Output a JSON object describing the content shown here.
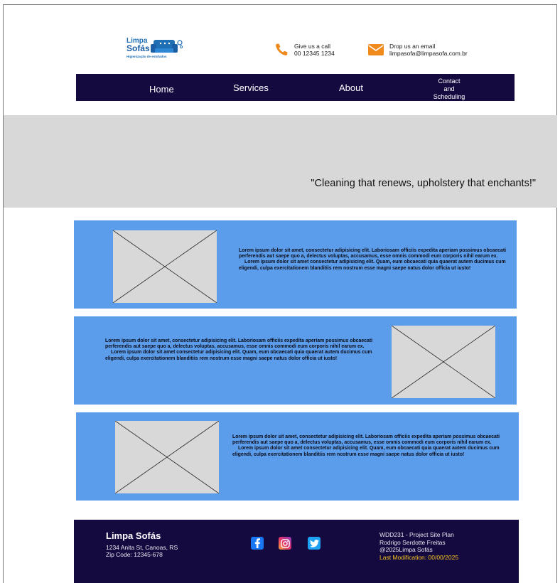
{
  "header": {
    "logo": {
      "line1": "Limpa",
      "line2": "Sofás",
      "tagline": "Higienização de estofados"
    },
    "call": {
      "title": "Give us a call",
      "value": "00 12345 1234",
      "icon": "phone-icon",
      "color": "#f08a1c"
    },
    "email": {
      "title": "Drop us an email",
      "value": "limpasofa@limpasofa.com.br",
      "icon": "mail-icon",
      "color": "#f08a1c"
    }
  },
  "nav": {
    "items": [
      {
        "label": "Home"
      },
      {
        "label": "Services"
      },
      {
        "label": "About"
      },
      {
        "label_lines": [
          "Contact",
          "and",
          "Scheduling"
        ]
      }
    ],
    "background": "#150a40"
  },
  "hero": {
    "quote": "\"Cleaning that renews, upholstery that enchants!\"",
    "background": "#d8d8d8"
  },
  "cards": [
    {
      "image": "image-placeholder",
      "p1": "Lorem ipsum dolor sit amet, consectetur adipisicing elit. Laboriosam officiis expedita aperiam possimus obcaecati perferendis aut saepe quo a, delectus voluptas, accusamus, esse omnis commodi eum corporis nihil earum ex.",
      "p2": "Lorem ipsum dolor sit amet consectetur adipisicing elit. Quam, eum obcaecati quia quaerat autem ducimus cum eligendi, culpa exercitationem blanditiis rem nostrum esse magni saepe natus dolor officia ut iusto!"
    },
    {
      "image": "image-placeholder",
      "p1": "Lorem ipsum dolor sit amet, consectetur adipisicing elit. Laboriosam officiis expedita aperiam possimus obcaecati perferendis aut saepe quo a, delectus voluptas, accusamus, esse omnis commodi eum corporis nihil earum ex.",
      "p2": "Lorem ipsum dolor sit amet consectetur adipisicing elit. Quam, eum obcaecati quia quaerat autem ducimus cum eligendi, culpa exercitationem blanditiis rem nostrum esse magni saepe natus dolor officia ut iusto!"
    },
    {
      "image": "image-placeholder",
      "p1": "Lorem ipsum dolor sit amet, consectetur adipisicing elit. Laboriosam officiis expedita aperiam possimus obcaecati perferendis aut saepe quo a, delectus voluptas, accusamus, esse omnis commodi eum corporis nihil earum ex.",
      "p2": "Lorem ipsum dolor sit amet consectetur adipisicing elit. Quam, eum obcaecati quia quaerat autem ducimus cum eligendi, culpa exercitationem blanditiis rem nostrum esse magni saepe natus dolor officia ut iusto!"
    }
  ],
  "card_color": "#5b9dea",
  "footer": {
    "brand": "Limpa Sofás",
    "address": "1234 Anita St, Canoas, RS",
    "zip": "Zip Code: 12345-678",
    "social": [
      "facebook-icon",
      "instagram-icon",
      "twitter-icon"
    ],
    "course": "WDD231 - Project Site Plan",
    "author": "Rodrigo Serdotte Freitas",
    "copyright": "@2025Limpa Sofás",
    "last_modified": "Last Modification: 00/00/2025",
    "accent": "#f5c518"
  }
}
